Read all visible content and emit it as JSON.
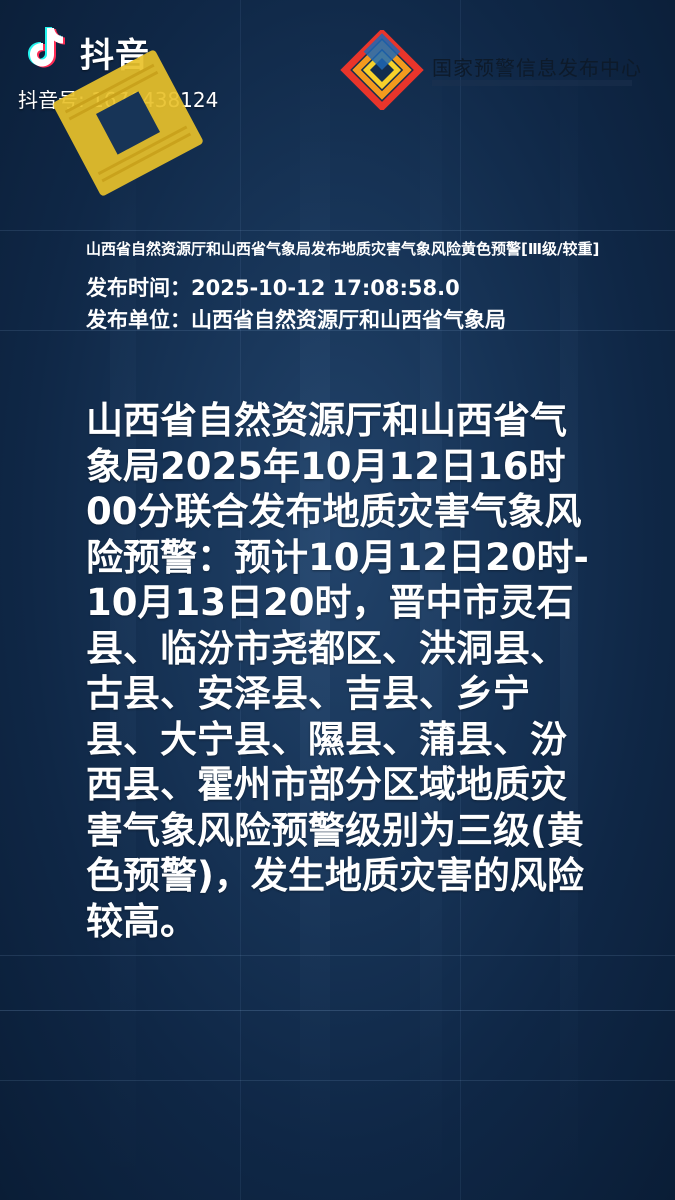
{
  "watermark": {
    "app_name": "抖音",
    "account_id": "抖音号: 1676438124"
  },
  "agency": {
    "name": "国家预警信息发布中心"
  },
  "notice": {
    "title": "山西省自然资源厅和山西省气象局发布地质灾害气象风险黄色预警[Ⅲ级/较重]",
    "time_line": "发布时间：2025-10-12 17:08:58.0",
    "unit_line": "发布单位：山西省自然资源厅和山西省气象局",
    "body": "山西省自然资源厅和山西省气象局2025年10月12日16时00分联合发布地质灾害气象风险预警：预计10月12日20时-10月13日20时，晋中市灵石县、临汾市尧都区、洪洞县、古县、安泽县、吉县、乡宁县、大宁县、隰县、蒲县、汾西县、霍州市部分区域地质灾害气象风险预警级别为三级(黄色预警)，发生地质灾害的风险较高。"
  },
  "colors": {
    "background": "#173457",
    "text": "#ffffff",
    "emblem_gold": "#e8c12a"
  }
}
